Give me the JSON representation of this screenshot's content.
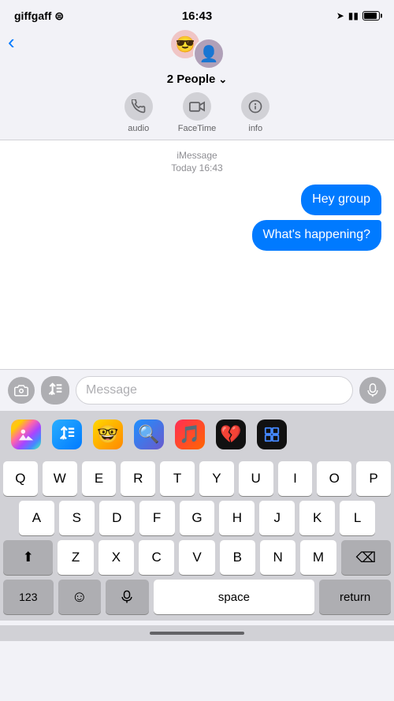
{
  "status": {
    "carrier": "giffgaff",
    "time": "16:43",
    "wifi": "wifi"
  },
  "header": {
    "back_label": "‹",
    "people_count": "2 People",
    "chevron": "˅",
    "avatar1_emoji": "😎",
    "avatar2_emoji": "👤",
    "action_audio": "audio",
    "action_facetime": "FaceTime",
    "action_info": "info"
  },
  "messages": {
    "service_label": "iMessage",
    "date_label": "Today 16:43",
    "bubbles": [
      {
        "text": "Hey group",
        "align": "right"
      },
      {
        "text": "What's happening?",
        "align": "right"
      }
    ]
  },
  "input": {
    "placeholder": "Message",
    "camera_icon": "📷",
    "apps_icon": "A",
    "audio_icon": "🎙"
  },
  "tray": {
    "photos_icon": "🖼",
    "appstore_icon": "A",
    "memoji_icon": "🤓",
    "search_icon": "🔍",
    "music_icon": "🎵",
    "heart_icon": "💔",
    "snippets_icon": "▣"
  },
  "keyboard": {
    "rows": [
      [
        "Q",
        "W",
        "E",
        "R",
        "T",
        "Y",
        "U",
        "I",
        "O",
        "P"
      ],
      [
        "A",
        "S",
        "D",
        "F",
        "G",
        "H",
        "J",
        "K",
        "L"
      ],
      [
        "⬆",
        "Z",
        "X",
        "C",
        "V",
        "B",
        "N",
        "M",
        "⌫"
      ],
      [
        "123",
        "☺",
        "🎤",
        "space",
        "return"
      ]
    ],
    "space_label": "space",
    "return_label": "return",
    "numbers_label": "123"
  }
}
